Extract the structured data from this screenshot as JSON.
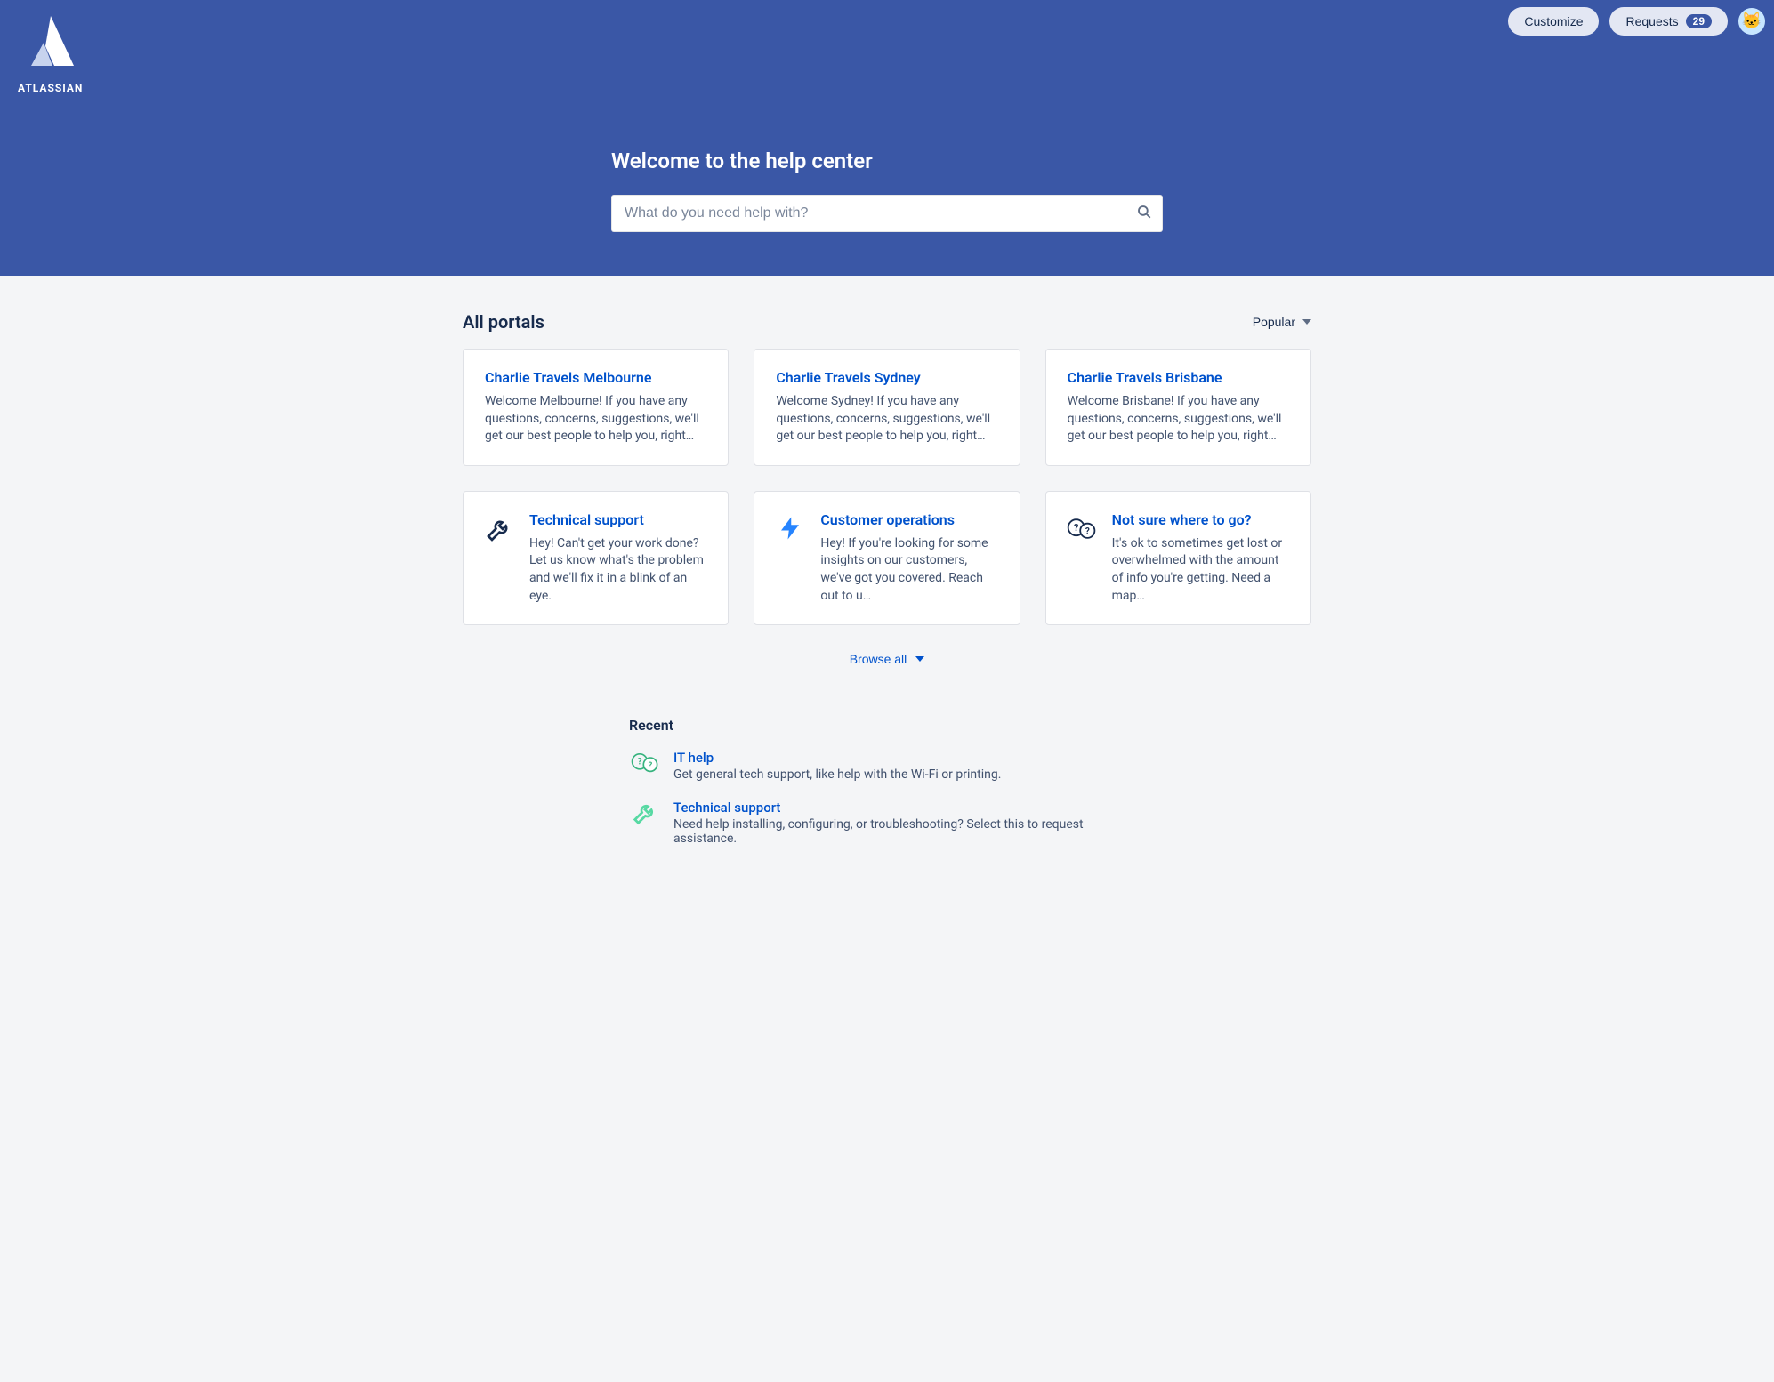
{
  "brand": {
    "name": "ATLASSIAN"
  },
  "top": {
    "customize_label": "Customize",
    "requests_label": "Requests",
    "requests_count": "29"
  },
  "hero": {
    "title": "Welcome to the help center",
    "search_placeholder": "What do you need help with?"
  },
  "portals": {
    "heading": "All portals",
    "sort_label": "Popular",
    "browse_all_label": "Browse all",
    "cards": [
      {
        "title": "Charlie Travels Melbourne",
        "desc": "Welcome Melbourne! If you have any questions, concerns, suggestions, we'll get our best people to help you, right…"
      },
      {
        "title": "Charlie Travels Sydney",
        "desc": "Welcome Sydney! If you have any questions, concerns, suggestions, we'll get our best people to help you, right…"
      },
      {
        "title": "Charlie Travels Brisbane",
        "desc": "Welcome Brisbane! If you have any questions, concerns, suggestions, we'll get our best people to help you, right…"
      },
      {
        "title": "Technical support",
        "desc": "Hey! Can't get your work done? Let us know what's the problem and we'll fix it in a blink of an eye."
      },
      {
        "title": "Customer operations",
        "desc": "Hey! If you're looking for some insights on our customers, we've got you covered. Reach out to u…"
      },
      {
        "title": "Not sure where to go?",
        "desc": "It's ok to sometimes get lost or overwhelmed with the amount of info you're getting. Need a map…"
      }
    ]
  },
  "recent": {
    "heading": "Recent",
    "items": [
      {
        "title": "IT help",
        "desc": "Get general tech support, like help with the Wi-Fi or printing."
      },
      {
        "title": "Technical support",
        "desc": "Need help installing, configuring, or troubleshooting? Select this to request assistance."
      }
    ]
  }
}
